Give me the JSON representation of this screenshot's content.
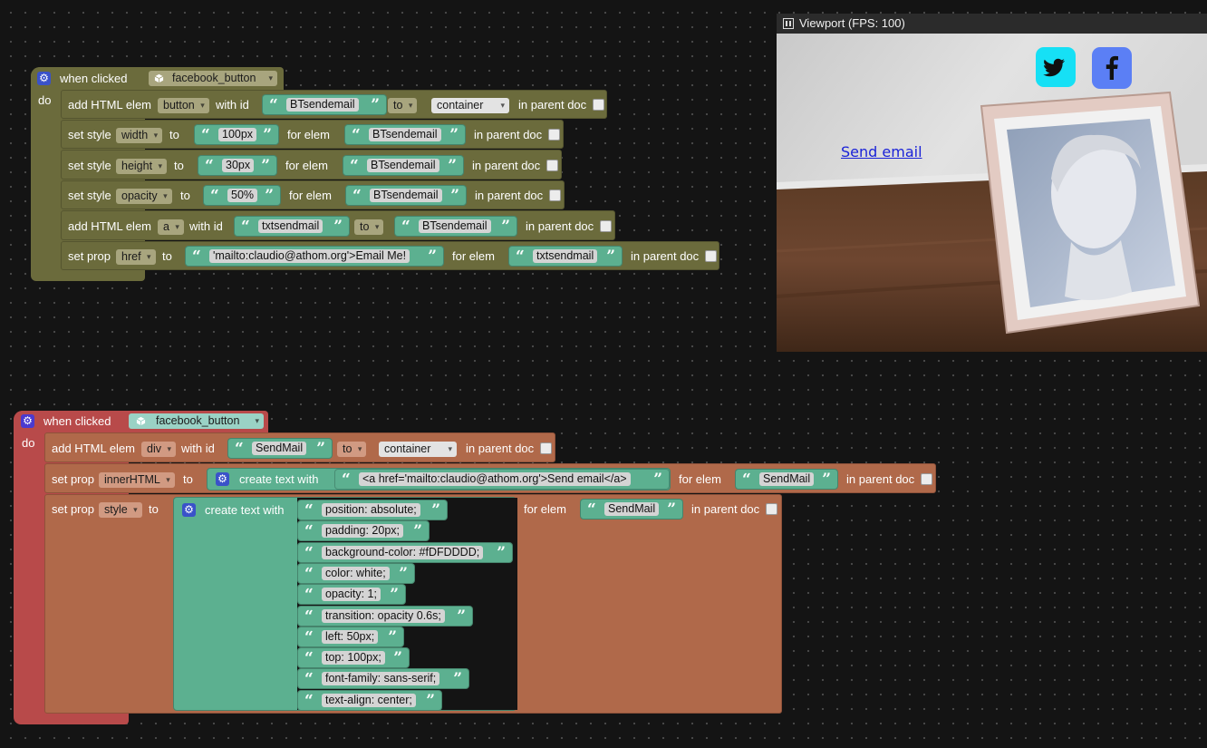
{
  "viewport": {
    "title": "Viewport (FPS: 100)",
    "link_text": "Send email"
  },
  "block1": {
    "hat": {
      "when": "when clicked",
      "target": "facebook_button"
    },
    "do": "do",
    "r1": {
      "a": "add HTML elem",
      "type": "button",
      "b": "with id",
      "id": "BTsendemail",
      "c": "to",
      "parent": "container",
      "d": "in parent doc"
    },
    "r2": {
      "a": "set style",
      "prop": "width",
      "b": "to",
      "val": "100px",
      "c": "for elem",
      "elem": "BTsendemail",
      "d": "in parent doc"
    },
    "r3": {
      "a": "set style",
      "prop": "height",
      "b": "to",
      "val": "30px",
      "c": "for elem",
      "elem": "BTsendemail",
      "d": "in parent doc"
    },
    "r4": {
      "a": "set style",
      "prop": "opacity",
      "b": "to",
      "val": "50%",
      "c": "for elem",
      "elem": "BTsendemail",
      "d": "in parent doc"
    },
    "r5": {
      "a": "add HTML elem",
      "type": "a",
      "b": "with id",
      "id": "txtsendmail",
      "c": "to",
      "parent": "BTsendemail",
      "d": "in parent doc"
    },
    "r6": {
      "a": "set prop",
      "prop": "href",
      "b": "to",
      "val": "'mailto:claudio@athom.org'>Email Me!",
      "c": "for elem",
      "elem": "txtsendmail",
      "d": "in parent doc"
    }
  },
  "block2": {
    "hat": {
      "when": "when clicked",
      "target": "facebook_button"
    },
    "do": "do",
    "r1": {
      "a": "add HTML elem",
      "type": "div",
      "b": "with id",
      "id": "SendMail",
      "c": "to",
      "parent": "container",
      "d": "in parent doc"
    },
    "r2": {
      "a": "set prop",
      "prop": "innerHTML",
      "b": "to",
      "create": "create text with",
      "val": "<a href='mailto:claudio@athom.org'>Send email</a>",
      "c": "for elem",
      "elem": "SendMail",
      "d": "in parent doc"
    },
    "r3": {
      "a": "set prop",
      "prop": "style",
      "b": "to",
      "create": "create text with",
      "c": "for elem",
      "elem": "SendMail",
      "d": "in parent doc",
      "items": [
        "position: absolute;",
        "padding: 20px;",
        "background-color: #fDFDDDD;",
        "color: white;",
        "opacity: 1;",
        "transition: opacity 0.6s;",
        "left: 50px;",
        "top: 100px;",
        "font-family: sans-serif;",
        "text-align: center;"
      ]
    }
  },
  "colors": {
    "olive": "#6b6b3c",
    "brick": "#b0694a",
    "red_hat": "#b84a4a",
    "text_green": "#5cb090",
    "gear_blue": "#3a52c9",
    "link_blue": "#1a22d8"
  }
}
